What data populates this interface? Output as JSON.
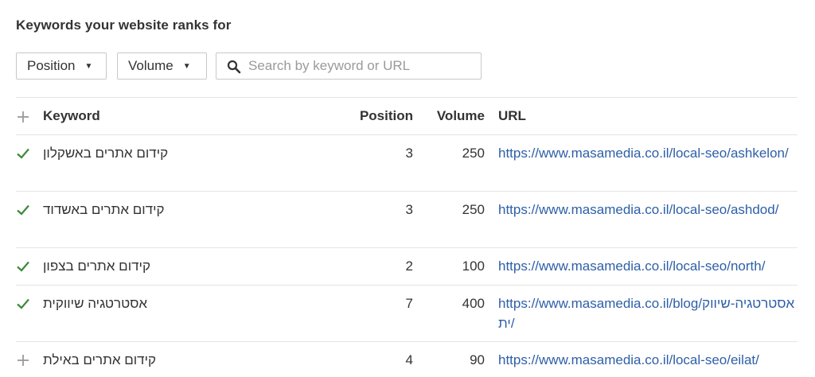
{
  "title": "Keywords your website ranks for",
  "filters": {
    "position_label": "Position",
    "volume_label": "Volume",
    "search_placeholder": "Search by keyword or URL"
  },
  "table": {
    "columns": {
      "keyword": "Keyword",
      "position": "Position",
      "volume": "Volume",
      "url": "URL"
    },
    "rows": [
      {
        "status": "tracked",
        "keyword": "קידום אתרים באשקלון",
        "position": "3",
        "volume": "250",
        "url": "https://www.masamedia.co.il/local-seo/ashkelon/"
      },
      {
        "status": "tracked",
        "keyword": "קידום אתרים באשדוד",
        "position": "3",
        "volume": "250",
        "url": "https://www.masamedia.co.il/local-seo/ashdod/"
      },
      {
        "status": "tracked",
        "keyword": "קידום אתרים בצפון",
        "position": "2",
        "volume": "100",
        "url": "https://www.masamedia.co.il/local-seo/north/"
      },
      {
        "status": "tracked",
        "keyword": "אסטרטגיה שיווקית",
        "position": "7",
        "volume": "400",
        "url": "https://www.masamedia.co.il/blog/אסטרטגיה-שיווקית/"
      },
      {
        "status": "add",
        "keyword": "קידום אתרים באילת",
        "position": "4",
        "volume": "90",
        "url": "https://www.masamedia.co.il/local-seo/eilat/"
      }
    ]
  },
  "colors": {
    "check": "#3c8a3a",
    "link": "#2d5fa8",
    "plus": "#9a9a9a"
  }
}
